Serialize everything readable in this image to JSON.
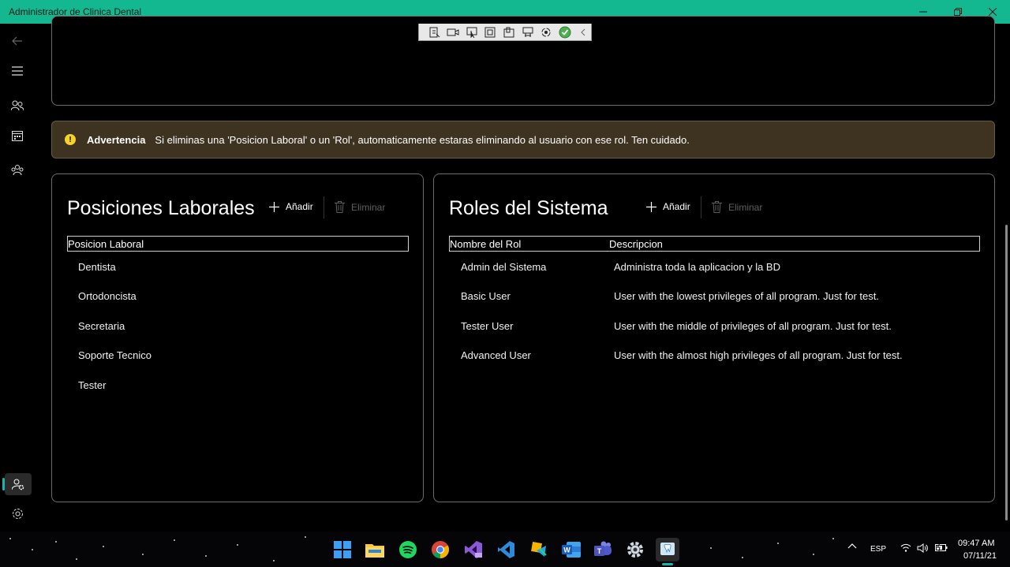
{
  "window": {
    "title": "Administrador de Clinica Dental",
    "minimize_icon": "minimize-icon",
    "maximize_icon": "restore-icon",
    "close_icon": "close-icon"
  },
  "sidebar": {
    "items": [
      {
        "name": "back-icon"
      },
      {
        "name": "menu-icon"
      },
      {
        "name": "people-icon"
      },
      {
        "name": "calendar-icon"
      },
      {
        "name": "users-group-icon"
      },
      {
        "name": "user-settings-icon",
        "active": true
      },
      {
        "name": "gear-icon"
      }
    ]
  },
  "warning": {
    "title": "Advertencia",
    "message": "Si eliminas una 'Posicion Laboral' o un 'Rol', automaticamente estaras eliminando al usuario con ese rol. Ten cuidado.",
    "color": "#3d3320"
  },
  "positions": {
    "title": "Posiciones Laborales",
    "add_label": "Añadir",
    "delete_label": "Eliminar",
    "column": "Posicion Laboral",
    "rows": [
      "Dentista",
      "Ortodoncista",
      "Secretaria",
      "Soporte Tecnico",
      "Tester"
    ]
  },
  "roles": {
    "title": "Roles del Sistema",
    "add_label": "Añadir",
    "delete_label": "Eliminar",
    "columns": [
      "Nombre del Rol",
      "Descripcion"
    ],
    "rows": [
      {
        "name": "Admin del Sistema",
        "desc": "Administra toda la aplicacion y la BD"
      },
      {
        "name": "Basic User",
        "desc": "User with the lowest privileges of all program. Just for test."
      },
      {
        "name": "Tester User",
        "desc": "User with the middle of privileges of all program. Just for test."
      },
      {
        "name": "Advanced User",
        "desc": "User with the almost high privileges of all program. Just for test."
      }
    ]
  },
  "taskbar": {
    "apps": [
      "windows-start-icon",
      "file-explorer-icon",
      "spotify-icon",
      "chrome-icon",
      "visual-studio-icon",
      "vscode-icon",
      "app-icon",
      "word-icon",
      "teams-icon",
      "settings-icon",
      "dental-app-icon"
    ],
    "language": "ESP",
    "time": "09:47 AM",
    "date": "07/11/21"
  },
  "colors": {
    "accent": "#14b890",
    "warning": "#f6d22a"
  }
}
